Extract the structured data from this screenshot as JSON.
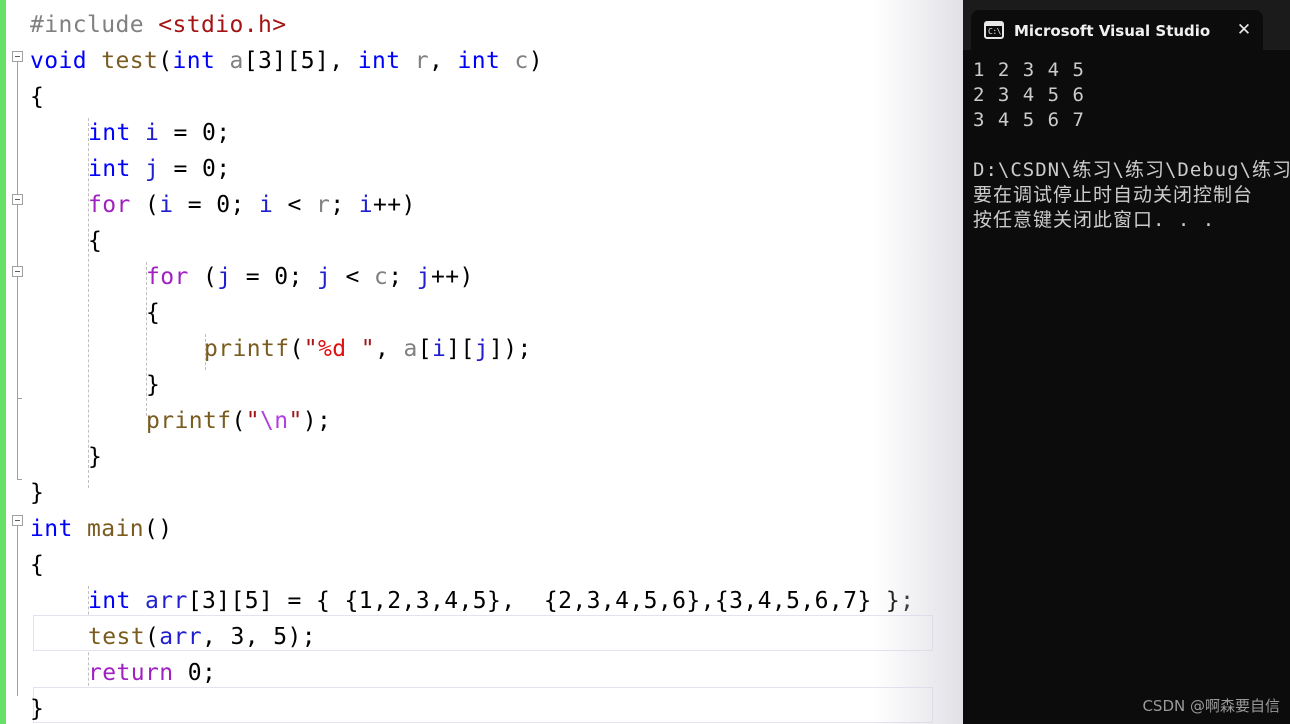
{
  "editor": {
    "name": "visual-studio-code-editor",
    "background": "#ffffff",
    "change_bar_color": "#66e066",
    "font_size_px": 23,
    "line_height_px": 36,
    "current_line_index": 17,
    "lines": [
      {
        "indent": 0,
        "tokens": [
          {
            "t": "#include ",
            "c": "pre"
          },
          {
            "t": "<stdio.h>",
            "c": "hdr"
          }
        ]
      },
      {
        "indent": 0,
        "tokens": [
          {
            "t": "void",
            "c": "kw"
          },
          {
            "t": " ",
            "c": "pun"
          },
          {
            "t": "test",
            "c": "fn"
          },
          {
            "t": "(",
            "c": "pun"
          },
          {
            "t": "int",
            "c": "kw"
          },
          {
            "t": " ",
            "c": "pun"
          },
          {
            "t": "a",
            "c": "id"
          },
          {
            "t": "[3][5], ",
            "c": "pun"
          },
          {
            "t": "int",
            "c": "kw"
          },
          {
            "t": " ",
            "c": "pun"
          },
          {
            "t": "r",
            "c": "id"
          },
          {
            "t": ", ",
            "c": "pun"
          },
          {
            "t": "int",
            "c": "kw"
          },
          {
            "t": " ",
            "c": "pun"
          },
          {
            "t": "c",
            "c": "id"
          },
          {
            "t": ")",
            "c": "pun"
          }
        ]
      },
      {
        "indent": 0,
        "tokens": [
          {
            "t": "{",
            "c": "pun"
          }
        ]
      },
      {
        "indent": 1,
        "tokens": [
          {
            "t": "int",
            "c": "kw"
          },
          {
            "t": " ",
            "c": "pun"
          },
          {
            "t": "i",
            "c": "var"
          },
          {
            "t": " = ",
            "c": "pun"
          },
          {
            "t": "0",
            "c": "pun"
          },
          {
            "t": ";",
            "c": "pun"
          }
        ]
      },
      {
        "indent": 1,
        "tokens": [
          {
            "t": "int",
            "c": "kw"
          },
          {
            "t": " ",
            "c": "pun"
          },
          {
            "t": "j",
            "c": "var"
          },
          {
            "t": " = ",
            "c": "pun"
          },
          {
            "t": "0",
            "c": "pun"
          },
          {
            "t": ";",
            "c": "pun"
          }
        ]
      },
      {
        "indent": 1,
        "tokens": [
          {
            "t": "for",
            "c": "ctrl"
          },
          {
            "t": " (",
            "c": "pun"
          },
          {
            "t": "i",
            "c": "var"
          },
          {
            "t": " = ",
            "c": "pun"
          },
          {
            "t": "0",
            "c": "pun"
          },
          {
            "t": "; ",
            "c": "pun"
          },
          {
            "t": "i",
            "c": "var"
          },
          {
            "t": " < ",
            "c": "pun"
          },
          {
            "t": "r",
            "c": "id"
          },
          {
            "t": "; ",
            "c": "pun"
          },
          {
            "t": "i",
            "c": "var"
          },
          {
            "t": "++)",
            "c": "pun"
          }
        ]
      },
      {
        "indent": 1,
        "tokens": [
          {
            "t": "{",
            "c": "pun"
          }
        ]
      },
      {
        "indent": 2,
        "tokens": [
          {
            "t": "for",
            "c": "ctrl"
          },
          {
            "t": " (",
            "c": "pun"
          },
          {
            "t": "j",
            "c": "var"
          },
          {
            "t": " = ",
            "c": "pun"
          },
          {
            "t": "0",
            "c": "pun"
          },
          {
            "t": "; ",
            "c": "pun"
          },
          {
            "t": "j",
            "c": "var"
          },
          {
            "t": " < ",
            "c": "pun"
          },
          {
            "t": "c",
            "c": "id"
          },
          {
            "t": "; ",
            "c": "pun"
          },
          {
            "t": "j",
            "c": "var"
          },
          {
            "t": "++)",
            "c": "pun"
          }
        ]
      },
      {
        "indent": 2,
        "tokens": [
          {
            "t": "{",
            "c": "pun"
          }
        ]
      },
      {
        "indent": 3,
        "tokens": [
          {
            "t": "printf",
            "c": "fn"
          },
          {
            "t": "(",
            "c": "pun"
          },
          {
            "t": "\"",
            "c": "str"
          },
          {
            "t": "%d",
            "c": "fmt"
          },
          {
            "t": " \"",
            "c": "str"
          },
          {
            "t": ", ",
            "c": "pun"
          },
          {
            "t": "a",
            "c": "id"
          },
          {
            "t": "[",
            "c": "pun"
          },
          {
            "t": "i",
            "c": "var"
          },
          {
            "t": "][",
            "c": "pun"
          },
          {
            "t": "j",
            "c": "var"
          },
          {
            "t": "]);",
            "c": "pun"
          }
        ]
      },
      {
        "indent": 2,
        "tokens": [
          {
            "t": "}",
            "c": "pun"
          }
        ]
      },
      {
        "indent": 2,
        "tokens": [
          {
            "t": "printf",
            "c": "fn"
          },
          {
            "t": "(",
            "c": "pun"
          },
          {
            "t": "\"",
            "c": "str"
          },
          {
            "t": "\\n",
            "c": "esc"
          },
          {
            "t": "\"",
            "c": "str"
          },
          {
            "t": ");",
            "c": "pun"
          }
        ]
      },
      {
        "indent": 1,
        "tokens": [
          {
            "t": "}",
            "c": "pun"
          }
        ]
      },
      {
        "indent": 0,
        "tokens": [
          {
            "t": "}",
            "c": "pun"
          }
        ]
      },
      {
        "indent": 0,
        "tokens": [
          {
            "t": "int",
            "c": "kw"
          },
          {
            "t": " ",
            "c": "pun"
          },
          {
            "t": "main",
            "c": "fn"
          },
          {
            "t": "()",
            "c": "pun"
          }
        ]
      },
      {
        "indent": 0,
        "tokens": [
          {
            "t": "{",
            "c": "pun"
          }
        ]
      },
      {
        "indent": 1,
        "tokens": [
          {
            "t": "int",
            "c": "kw"
          },
          {
            "t": " ",
            "c": "pun"
          },
          {
            "t": "arr",
            "c": "var"
          },
          {
            "t": "[3][5] = { {1,2,3,4,5},  {2,3,4,5,6},{3,4,5,6,7} };",
            "c": "pun"
          }
        ]
      },
      {
        "indent": 1,
        "tokens": [
          {
            "t": "test",
            "c": "fn"
          },
          {
            "t": "(",
            "c": "pun"
          },
          {
            "t": "arr",
            "c": "var"
          },
          {
            "t": ", 3, 5);",
            "c": "pun"
          }
        ]
      },
      {
        "indent": 1,
        "tokens": [
          {
            "t": "return",
            "c": "ctrl"
          },
          {
            "t": " 0;",
            "c": "pun"
          }
        ]
      },
      {
        "indent": 0,
        "tokens": [
          {
            "t": "}",
            "c": "pun"
          }
        ]
      }
    ]
  },
  "console": {
    "title": "Microsoft Visual Studio 调试控",
    "icon": "console-cmd-icon",
    "close_label": "✕",
    "background": "#0c0c0c",
    "text_color": "#cccccc",
    "output_rows": [
      "1 2 3 4 5",
      "2 3 4 5 6",
      "3 4 5 6 7"
    ],
    "message_lines": [
      "D:\\CSDN\\练习\\练习\\Debug\\练习",
      "要在调试停止时自动关闭控制台",
      "按任意键关闭此窗口. . ."
    ],
    "watermark": "CSDN @啊森要自信"
  }
}
